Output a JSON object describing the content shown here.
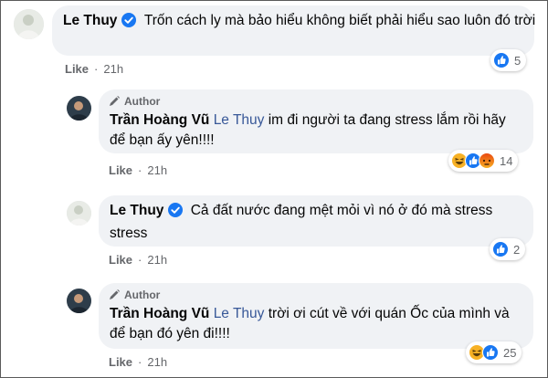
{
  "comments": [
    {
      "author": "Le Thuy",
      "verified": true,
      "text": "Trốn cách ly mà bảo hiểu không biết phải hiểu sao luôn đó trời",
      "like_label": "Like",
      "time": "21h",
      "reaction_count": "5",
      "reactions": [
        "like-icon"
      ]
    },
    {
      "author_badge": "Author",
      "author": "Trần Hoàng Vũ",
      "mention": "Le Thuy",
      "text": " im đi người ta đang stress lắm rồi hãy để bạn ấy yên!!!!",
      "like_label": "Like",
      "time": "21h",
      "reaction_count": "14",
      "reactions": [
        "haha-icon",
        "like-icon",
        "angry-icon"
      ]
    },
    {
      "author": "Le Thuy",
      "verified": true,
      "text": "Cả đất nước đang mệt mỏi vì nó ở đó mà stress stress",
      "like_label": "Like",
      "time": "21h",
      "reaction_count": "2",
      "reactions": [
        "like-icon"
      ]
    },
    {
      "author_badge": "Author",
      "author": "Trần Hoàng Vũ",
      "mention": "Le Thuy",
      "text": " trời ơi cút về với quán Ốc của mình và để bạn đó yên đi!!!!",
      "like_label": "Like",
      "time": "21h",
      "reaction_count": "25",
      "reactions": [
        "haha-icon",
        "like-icon"
      ]
    }
  ],
  "separator": "·",
  "colors": {
    "bubble": "#f0f2f5",
    "link": "#385898",
    "meta": "#65676b",
    "like_blue": "#1877f2",
    "haha_yellow": "#f7b125",
    "angry_orange": "#e9710f"
  }
}
